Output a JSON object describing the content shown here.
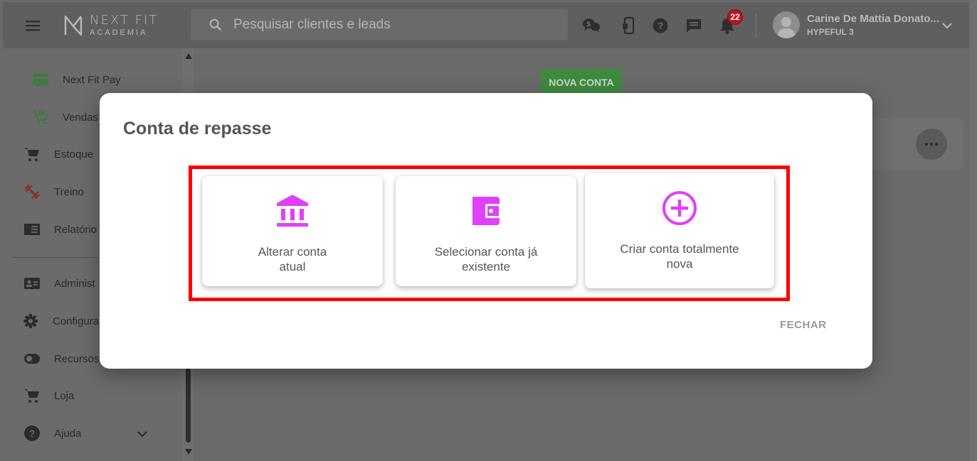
{
  "brand": {
    "line1": "NEXT FIT",
    "line2": "ACADEMIA",
    "icon": "next-fit-logo"
  },
  "header": {
    "search_placeholder": "Pesquisar clientes e leads",
    "notification_count": "22",
    "user_name": "Carine De Mattia Donato...",
    "user_org": "HYPEFUL 3",
    "icons": [
      "menu-icon",
      "search-icon",
      "chat-money-icon",
      "mobile-icon",
      "help-icon",
      "message-icon",
      "bell-icon",
      "chevron-down-icon"
    ]
  },
  "sidebar": {
    "items": [
      {
        "label": "Next Fit Pay",
        "icon": "credit-card-icon"
      },
      {
        "label": "Vendas",
        "icon": "cart-plus-icon"
      },
      {
        "label": "Estoque",
        "icon": "cart-icon"
      },
      {
        "label": "Treino",
        "icon": "dumbbell-icon"
      },
      {
        "label": "Relatório",
        "icon": "report-icon"
      },
      {
        "label": "Administ",
        "icon": "id-card-icon"
      },
      {
        "label": "Configura",
        "icon": "gear-icon"
      },
      {
        "label": "Recursos",
        "icon": "toggle-icon"
      },
      {
        "label": "Loja",
        "icon": "cart-icon"
      },
      {
        "label": "Ajuda",
        "icon": "help-circle-icon"
      }
    ]
  },
  "main": {
    "new_account_button": "NOVA CONTA"
  },
  "modal": {
    "title": "Conta de repasse",
    "options": [
      {
        "line1": "Alterar conta",
        "line2": "atual",
        "icon": "bank-icon"
      },
      {
        "line1": "Selecionar conta já",
        "line2": "existente",
        "icon": "wallet-icon"
      },
      {
        "line1": "Criar conta totalmente",
        "line2": "nova",
        "icon": "plus-circle-icon"
      }
    ],
    "close_label": "FECHAR"
  },
  "colors": {
    "accent_magenta": "#e040fb",
    "highlight_red": "#ff0000",
    "overlay_dim": "#6b6b6b",
    "green_button": "#3e8a3f",
    "badge_red": "#b8151b"
  }
}
